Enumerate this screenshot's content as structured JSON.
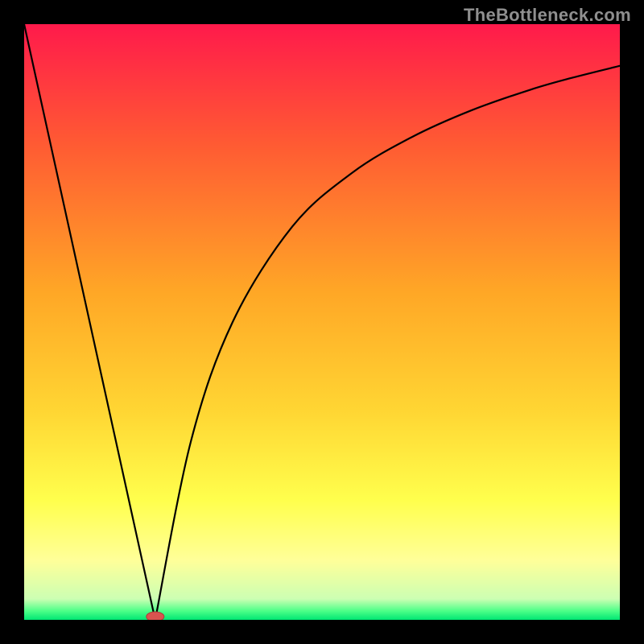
{
  "attribution": "TheBottleneck.com",
  "chart_data": {
    "type": "line",
    "title": "",
    "xlabel": "",
    "ylabel": "",
    "xlim": [
      0,
      100
    ],
    "ylim": [
      0,
      100
    ],
    "min_point_x": 22,
    "left": {
      "x": [
        0,
        11,
        22
      ],
      "y": [
        100,
        50,
        0
      ]
    },
    "right": {
      "x": [
        22,
        28,
        35,
        45,
        55,
        65,
        75,
        85,
        92,
        100
      ],
      "y": [
        0,
        30,
        50,
        66,
        75,
        81,
        85.5,
        89,
        91,
        93
      ]
    },
    "marker": {
      "x": 22,
      "y": 0,
      "color": "#d9534f"
    },
    "gradient_stops": [
      {
        "offset": 0.0,
        "color": "#ff1a4b"
      },
      {
        "offset": 0.2,
        "color": "#ff5a33"
      },
      {
        "offset": 0.45,
        "color": "#ffa726"
      },
      {
        "offset": 0.65,
        "color": "#ffd633"
      },
      {
        "offset": 0.8,
        "color": "#ffff4d"
      },
      {
        "offset": 0.9,
        "color": "#ffff99"
      },
      {
        "offset": 0.965,
        "color": "#ccffb3"
      },
      {
        "offset": 0.985,
        "color": "#4dff88"
      },
      {
        "offset": 1.0,
        "color": "#00e673"
      }
    ]
  }
}
